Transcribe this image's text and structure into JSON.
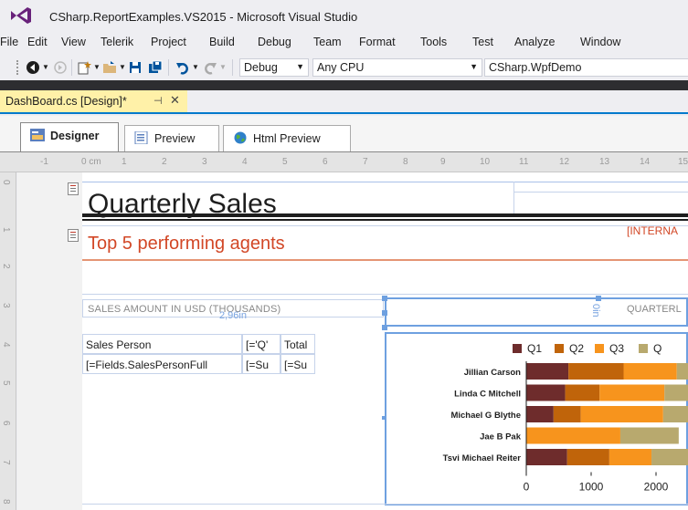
{
  "window": {
    "title": "CSharp.ReportExamples.VS2015 - Microsoft Visual Studio"
  },
  "menu": [
    "File",
    "Edit",
    "View",
    "Telerik",
    "Project",
    "Build",
    "Debug",
    "Team",
    "Format",
    "Tools",
    "Test",
    "Analyze",
    "Window"
  ],
  "toolbar": {
    "config": "Debug",
    "platform": "Any CPU",
    "startup": "CSharp.WpfDemo"
  },
  "document_tab": {
    "label": "DashBoard.cs [Design]*",
    "pin": "⊣",
    "close": "✕"
  },
  "designer_tabs": [
    {
      "label": "Designer"
    },
    {
      "label": "Preview"
    },
    {
      "label": "Html Preview"
    }
  ],
  "ruler": {
    "h": [
      "-1",
      "0 cm",
      "1",
      "2",
      "3",
      "4",
      "5",
      "6",
      "7",
      "8",
      "9",
      "10",
      "11",
      "12",
      "13",
      "14",
      "15"
    ],
    "v": [
      "0 cm",
      "1",
      "2",
      "3",
      "4",
      "5",
      "6",
      "7",
      "8"
    ]
  },
  "report": {
    "title": "Quarterly Sales",
    "internal": "[INTERNA",
    "subtitle": "Top 5 performing agents",
    "sales_amount_label": "SALES AMOUNT IN USD (THOUSANDS)",
    "size_readout": "2,96in",
    "height_readout": "0in",
    "quarter_label": "QUARTERL",
    "table": {
      "headers": [
        "Sales Person",
        "[='Q'",
        "Total"
      ],
      "row": [
        "[=Fields.SalesPersonFull",
        "[=Su",
        "[=Su"
      ]
    }
  },
  "chart_data": {
    "type": "bar",
    "orientation": "horizontal",
    "stacked": true,
    "categories": [
      "Jillian  Carson",
      "Linda C Mitchell",
      "Michael G Blythe",
      "Jae B Pak",
      "Tsvi Michael Reiter"
    ],
    "series": [
      {
        "name": "Q1",
        "color": "#6e2c2c",
        "values": [
          650,
          600,
          420,
          0,
          630
        ]
      },
      {
        "name": "Q2",
        "color": "#c0640a",
        "values": [
          850,
          530,
          420,
          0,
          650
        ]
      },
      {
        "name": "Q3",
        "color": "#f7941d",
        "values": [
          820,
          1000,
          1270,
          1450,
          650
        ]
      },
      {
        "name": "Q",
        "color": "#b8a96e",
        "values": [
          900,
          800,
          900,
          900,
          900
        ]
      }
    ],
    "x_ticks": [
      "0",
      "1000",
      "2000"
    ],
    "xlim": [
      0,
      2200
    ]
  }
}
